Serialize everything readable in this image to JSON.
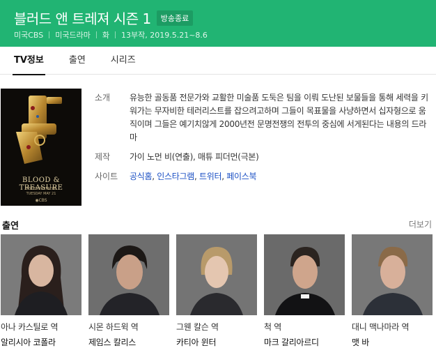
{
  "header": {
    "title": "블러드 앤 트레져 시즌 1",
    "badge": "방송종료",
    "meta": [
      "미국CBS",
      "미국드라마",
      "화",
      "13부작, 2019.5.21~8.6"
    ],
    "color": "#21b473"
  },
  "tabs": [
    {
      "label": "TV정보",
      "active": true
    },
    {
      "label": "출연",
      "active": false
    },
    {
      "label": "시리즈",
      "active": false
    }
  ],
  "poster": {
    "title": "BLOOD & TREASURE",
    "line1": "SERIES PREMIERE",
    "line2": "TUESDAY MAY 21",
    "logo": "◉CBS"
  },
  "info": {
    "synopsis_label": "소개",
    "synopsis": "유능한 골동품 전문가와 교활한 미술품 도둑은 팀을 이뤄 도난된 보물들을 통해 세력을 키워가는 무자비한 테러리스트를 잡으려고하며 그들이 목표물을 사냥하면서 십자형으로 움직이며 그들은 예기치않게 2000년전 문명전쟁의 전투의 중심에 서게된다는 내용의 드라마",
    "production_label": "제작",
    "production": "가이 노먼 비(연출), 매튜 피더먼(극본)",
    "site_label": "사이트",
    "sites": [
      "공식홈",
      "인스타그램",
      "트위터",
      "페이스북"
    ]
  },
  "cast_section": {
    "title": "출연",
    "more": "더보기"
  },
  "cast": [
    {
      "role": "아나 카스틸로 역",
      "name": "알리시아 코폴라"
    },
    {
      "role": "시몬 하드윅 역",
      "name": "제임스 칼리스"
    },
    {
      "role": "그웬 칼슨 역",
      "name": "카티아 윈터"
    },
    {
      "role": "척 역",
      "name": "마크 갈리아르디"
    },
    {
      "role": "대니 맥나마라 역",
      "name": "맷 바"
    }
  ]
}
